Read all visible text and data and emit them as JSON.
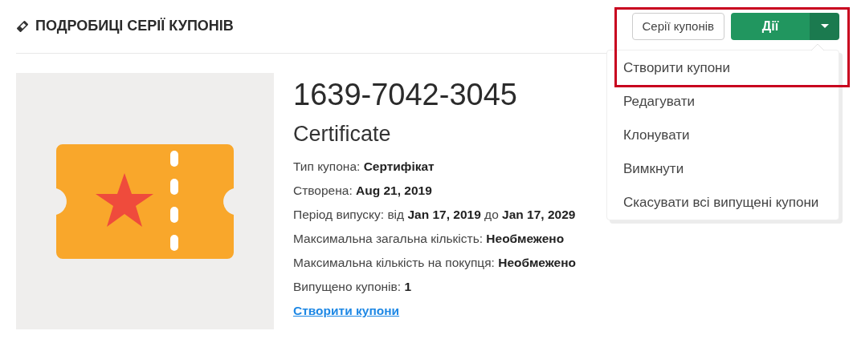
{
  "page": {
    "title": "ПОДРОБИЦІ СЕРІЇ КУПОНІВ"
  },
  "actions": {
    "series_button": "Серії купонів",
    "main_button": "Дії",
    "menu_open": true,
    "highlight_frame": true,
    "menu": [
      {
        "label": "Створити купони"
      },
      {
        "label": "Редагувати"
      },
      {
        "label": "Клонувати"
      },
      {
        "label": "Вимкнути"
      },
      {
        "label": "Скасувати всі випущені купони"
      }
    ]
  },
  "coupon": {
    "code": "1639-7042-3045",
    "name": "Certificate",
    "details": [
      "Тип купона: **Сертифікат**",
      "Створена: **Aug 21, 2019**",
      "Період випуску: від **Jan 17, 2019** до **Jan 17, 2029**",
      "Максимальна загальна кількість: **Необмежено**",
      "Максимальна кількість на покупця: **Необмежено**",
      "Випущено купонів: **1**"
    ],
    "link": "Створити купони"
  }
}
